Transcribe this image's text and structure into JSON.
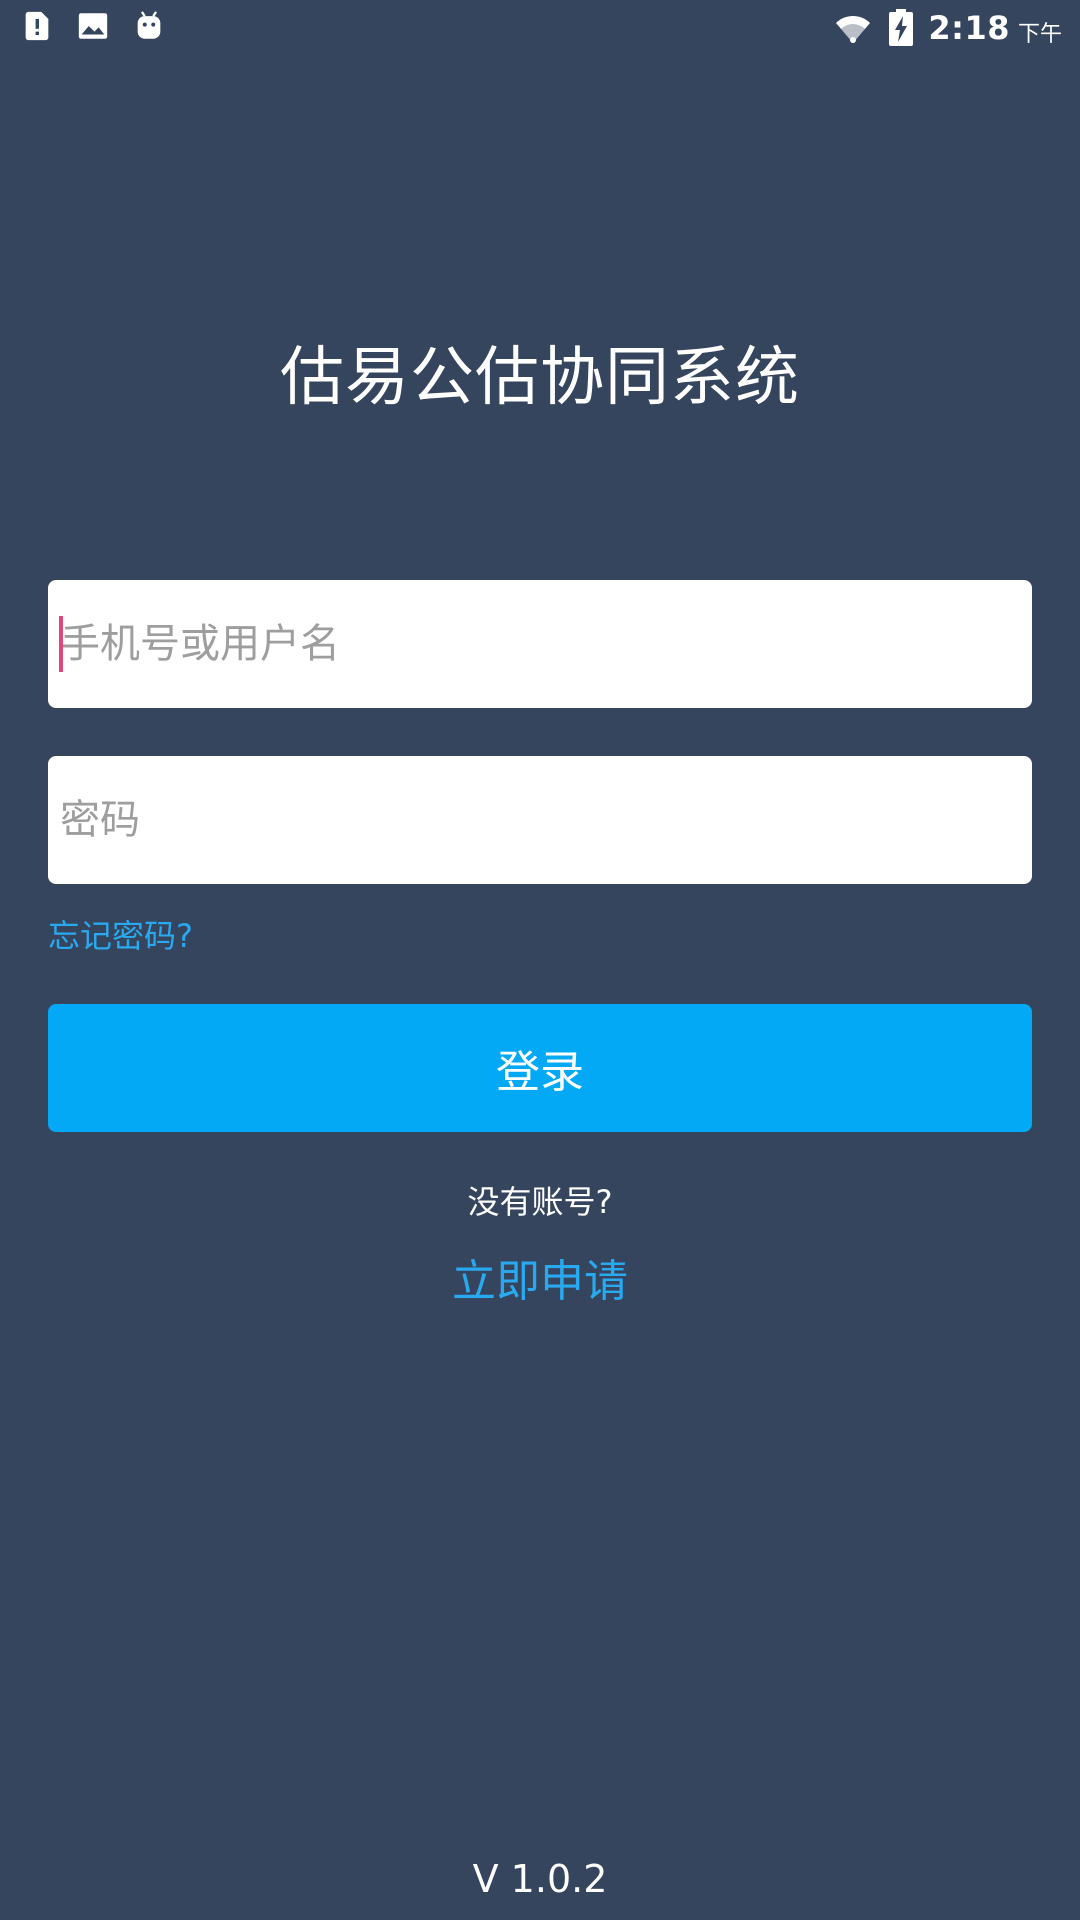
{
  "status_bar": {
    "icons_left": [
      "sd-card-alert-icon",
      "image-icon",
      "android-icon"
    ],
    "icons_right": [
      "wifi-icon",
      "battery-charging-icon"
    ],
    "time": "2:18",
    "ampm": "下午"
  },
  "login": {
    "title": "估易公估协同系统",
    "username_placeholder": "手机号或用户名",
    "username_value": "",
    "password_placeholder": "密码",
    "password_value": "",
    "forgot_label": "忘记密码?",
    "submit_label": "登录",
    "no_account_text": "没有账号?",
    "apply_label": "立即申请"
  },
  "footer": {
    "version": "V 1.0.2"
  },
  "colors": {
    "background": "#36455E",
    "primary_button": "#03A9F4",
    "link": "#29A9EF",
    "caret": "#E0457B"
  }
}
